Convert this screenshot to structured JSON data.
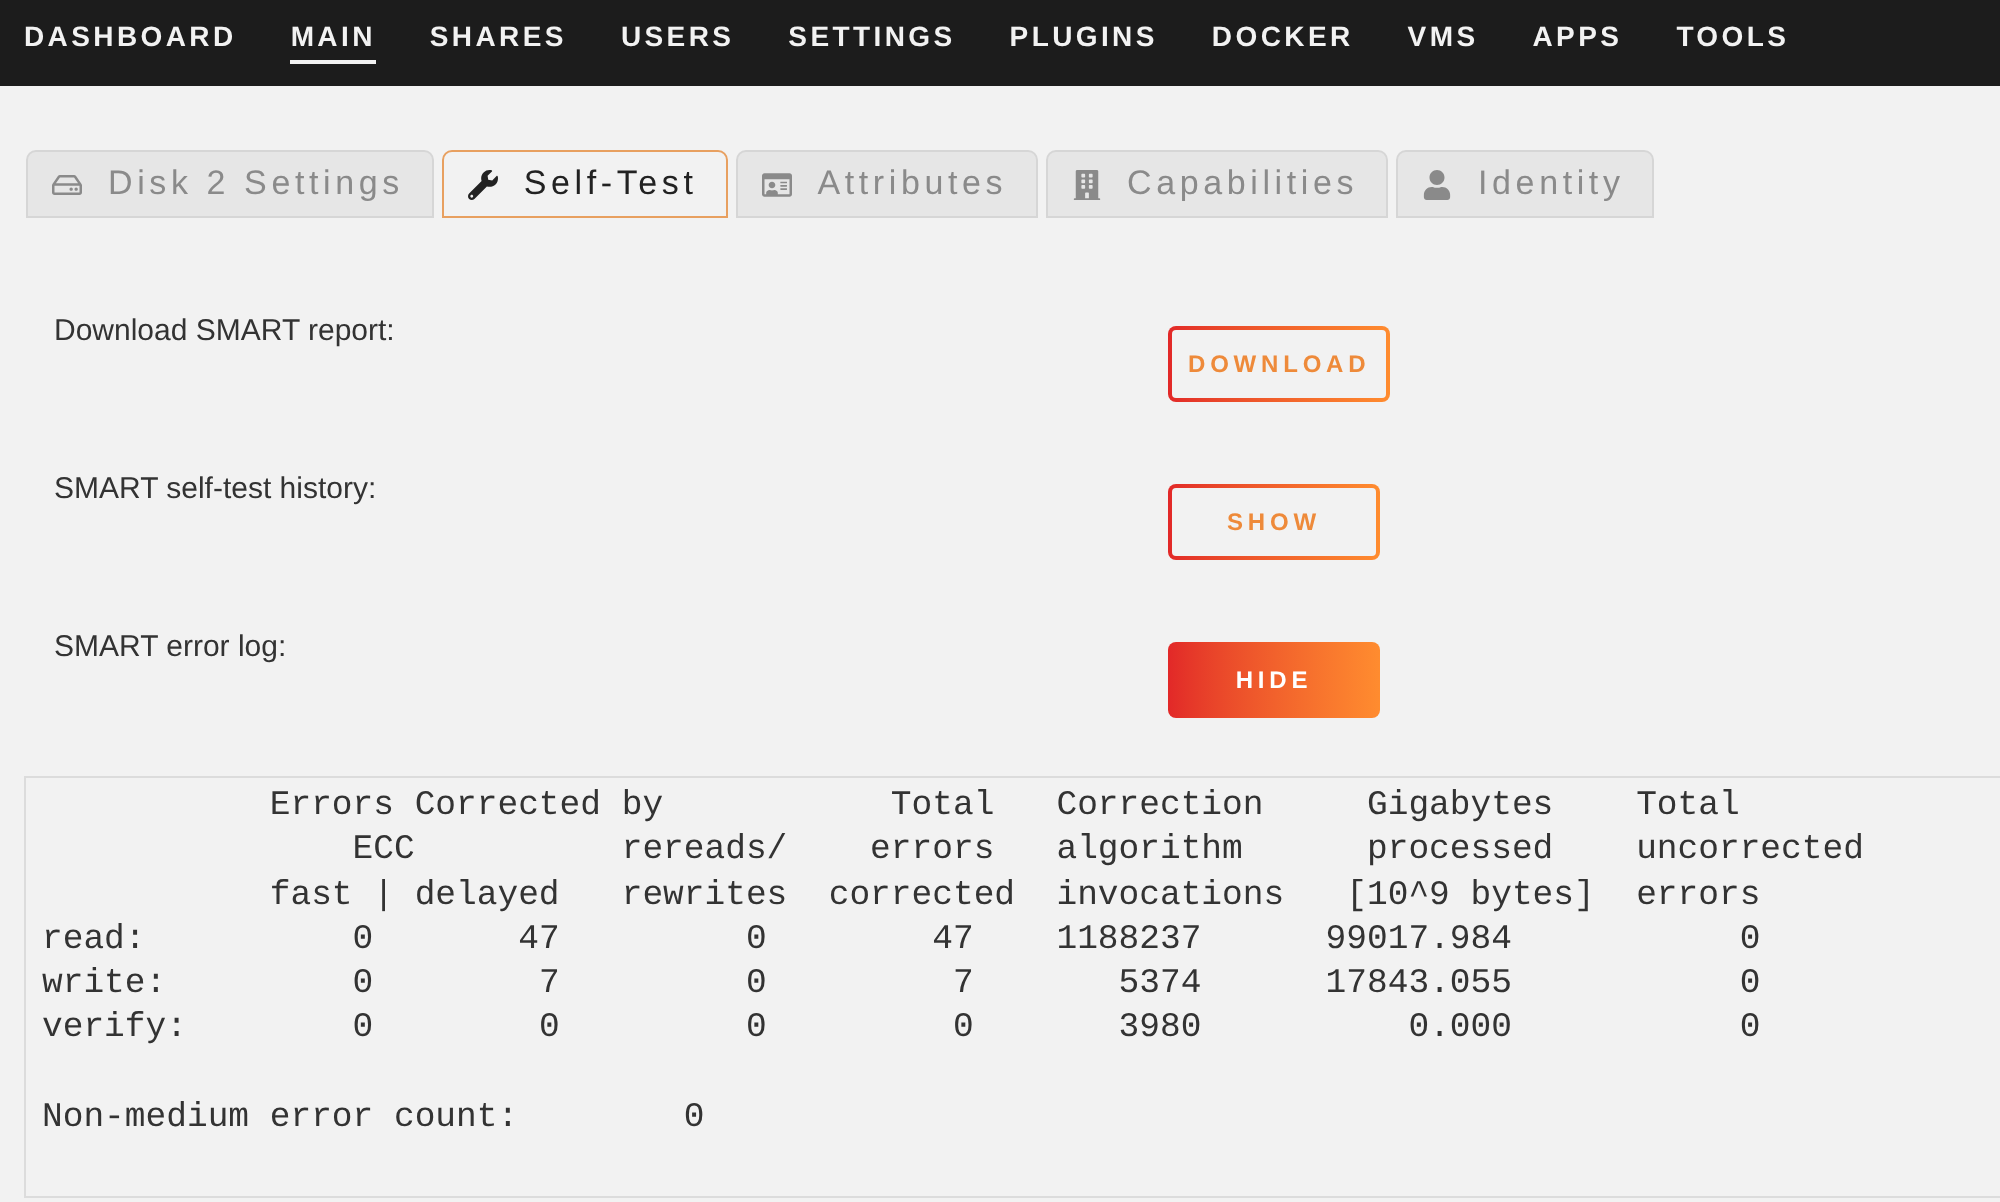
{
  "nav": {
    "items": [
      {
        "label": "DASHBOARD",
        "selected": false
      },
      {
        "label": "MAIN",
        "selected": true
      },
      {
        "label": "SHARES",
        "selected": false
      },
      {
        "label": "USERS",
        "selected": false
      },
      {
        "label": "SETTINGS",
        "selected": false
      },
      {
        "label": "PLUGINS",
        "selected": false
      },
      {
        "label": "DOCKER",
        "selected": false
      },
      {
        "label": "VMS",
        "selected": false
      },
      {
        "label": "APPS",
        "selected": false
      },
      {
        "label": "TOOLS",
        "selected": false
      }
    ]
  },
  "tabs": [
    {
      "label": "Disk 2 Settings",
      "selected": false
    },
    {
      "label": "Self-Test",
      "selected": true
    },
    {
      "label": "Attributes",
      "selected": false
    },
    {
      "label": "Capabilities",
      "selected": false
    },
    {
      "label": "Identity",
      "selected": false
    }
  ],
  "settings_rows": [
    {
      "label": "Download SMART report:",
      "button": {
        "label": "DOWNLOAD",
        "active": false
      }
    },
    {
      "label": "SMART self-test history:",
      "button": {
        "label": "SHOW",
        "active": false
      }
    },
    {
      "label": "SMART error log:",
      "button": {
        "label": "HIDE",
        "active": true
      }
    }
  ],
  "error_log": {
    "header_lines": [
      "           Errors Corrected by           Total   Correction     Gigabytes    Total",
      "               ECC          rereads/    errors   algorithm      processed    uncorrected",
      "           fast | delayed   rewrites  corrected  invocations   [10^9 bytes]  errors"
    ],
    "rows": [
      "read:          0       47         0        47    1188237      99017.984           0",
      "write:         0        7         0         7       5374      17843.055           0",
      "verify:        0        0         0         0       3980          0.000           0"
    ],
    "footer": "Non-medium error count:        0"
  }
}
